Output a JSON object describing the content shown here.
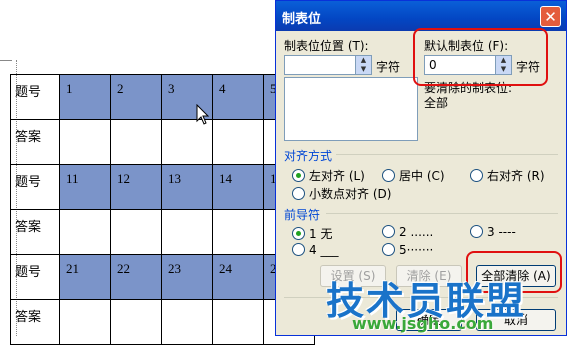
{
  "document": {
    "label_question": "题号",
    "label_answer": "答案",
    "rows": [
      {
        "label": "题号",
        "type": "num",
        "cells": [
          "1",
          "2",
          "3",
          "4",
          "5"
        ]
      },
      {
        "label": "答案",
        "type": "ans",
        "cells": [
          "",
          "",
          "",
          "",
          ""
        ]
      },
      {
        "label": "题号",
        "type": "num",
        "cells": [
          "11",
          "12",
          "13",
          "14",
          "15"
        ]
      },
      {
        "label": "答案",
        "type": "ans",
        "cells": [
          "",
          "",
          "",
          "",
          ""
        ]
      },
      {
        "label": "题号",
        "type": "num",
        "cells": [
          "21",
          "22",
          "23",
          "24",
          "25"
        ]
      },
      {
        "label": "答案",
        "type": "ans",
        "cells": [
          "",
          "",
          "",
          "",
          ""
        ]
      }
    ]
  },
  "dialog": {
    "title": "制表位",
    "tab_position_label": "制表位位置 (T):",
    "tab_position_value": "",
    "default_tab_label": "默认制表位 (F):",
    "default_tab_value": "0",
    "unit_chars": "字符",
    "to_clear_label": "要清除的制表位:",
    "to_clear_value": "全部",
    "alignment_group": "对齐方式",
    "align_left": "左对齐 (L)",
    "align_center": "居中 (C)",
    "align_right": "右对齐 (R)",
    "align_decimal": "小数点对齐 (D)",
    "leader_group": "前导符",
    "leader_1": "1 无",
    "leader_2": "2 ......",
    "leader_3": "3 ----",
    "leader_4": "4 ___",
    "leader_5": "5·······",
    "set_button": "设置 (S)",
    "clear_button": "清除 (E)",
    "clear_all_button": "全部清除 (A)",
    "ok_button": "确定",
    "cancel_button": "取消"
  },
  "watermark": {
    "title": "技术员联盟",
    "url": "www.jsgho.com"
  },
  "colors": {
    "highlight_cell": "#7b94c9",
    "annotation_red": "#e01010",
    "watermark_blue": "#1a73c9",
    "watermark_green": "#3aa83a"
  }
}
